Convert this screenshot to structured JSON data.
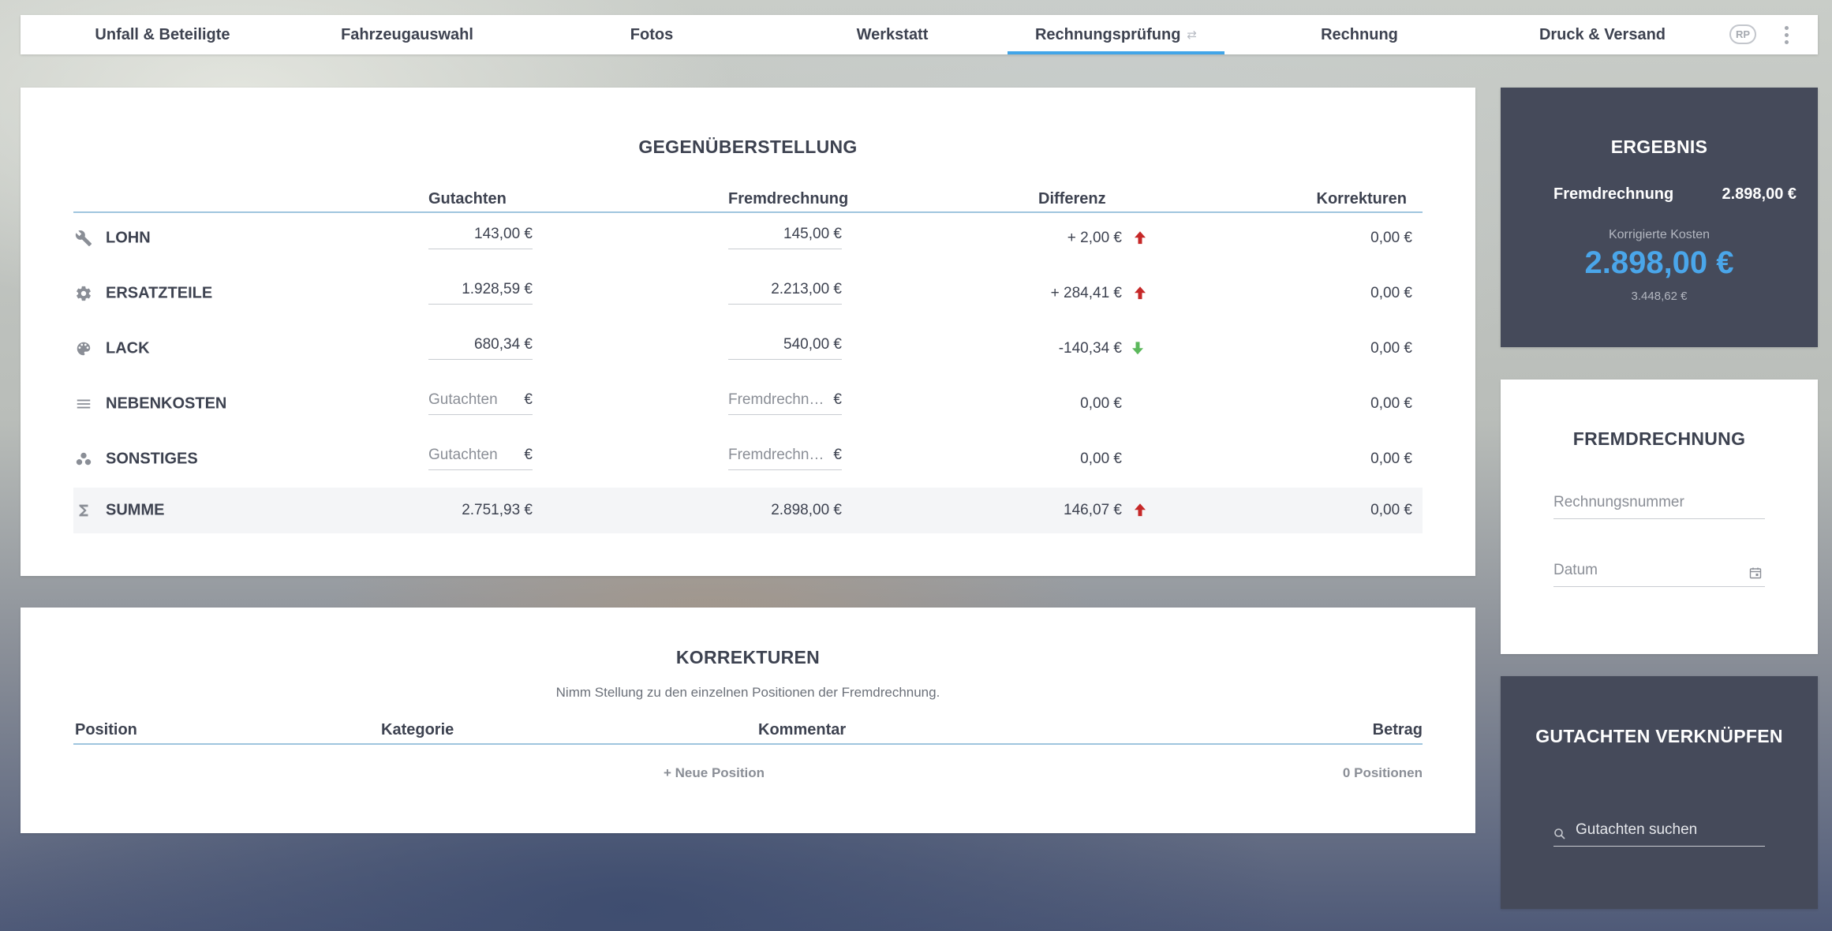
{
  "nav": {
    "tabs": [
      {
        "label": "Unfall & Beteiligte"
      },
      {
        "label": "Fahrzeugauswahl"
      },
      {
        "label": "Fotos"
      },
      {
        "label": "Werkstatt"
      },
      {
        "label": "Rechnungsprüfung",
        "active": true
      },
      {
        "label": "Rechnung"
      },
      {
        "label": "Druck & Versand"
      }
    ],
    "user_badge": "RP"
  },
  "comparison": {
    "title": "GEGENÜBERSTELLUNG",
    "columns": {
      "gutachten": "Gutachten",
      "fremdrechnung": "Fremdrechnung",
      "differenz": "Differenz",
      "korrekturen": "Korrekturen"
    },
    "rows": [
      {
        "label": "LOHN",
        "icon": "wrench-icon",
        "gutachten": "143,00 €",
        "fremdrechnung": "145,00 €",
        "differenz": "+ 2,00 €",
        "trend": "up",
        "korrekturen": "0,00 €"
      },
      {
        "label": "ERSATZTEILE",
        "icon": "gear-icon",
        "gutachten": "1.928,59 €",
        "fremdrechnung": "2.213,00 €",
        "differenz": "+ 284,41 €",
        "trend": "up",
        "korrekturen": "0,00 €"
      },
      {
        "label": "LACK",
        "icon": "palette-icon",
        "gutachten": "680,34 €",
        "fremdrechnung": "540,00 €",
        "differenz": "-140,34 €",
        "trend": "down",
        "korrekturen": "0,00 €"
      },
      {
        "label": "NEBENKOSTEN",
        "icon": "list-icon",
        "gutachten_placeholder": "Gutachten",
        "fremdrechnung_placeholder": "Fremdrechn…",
        "currency": "€",
        "differenz": "0,00 €",
        "korrekturen": "0,00 €"
      },
      {
        "label": "SONSTIGES",
        "icon": "dots-cluster-icon",
        "gutachten_placeholder": "Gutachten",
        "fremdrechnung_placeholder": "Fremdrechn…",
        "currency": "€",
        "differenz": "0,00 €",
        "korrekturen": "0,00 €"
      }
    ],
    "sum": {
      "label": "SUMME",
      "icon": "sigma-icon",
      "gutachten": "2.751,93 €",
      "fremdrechnung": "2.898,00 €",
      "differenz": "146,07 €",
      "trend": "up",
      "korrekturen": "0,00 €"
    }
  },
  "corrections": {
    "title": "KORREKTUREN",
    "subtitle": "Nimm Stellung zu den einzelnen Positionen der Fremdrechnung.",
    "columns": {
      "position": "Position",
      "kategorie": "Kategorie",
      "kommentar": "Kommentar",
      "betrag": "Betrag"
    },
    "new_position": "+ Neue Position",
    "count": "0 Positionen"
  },
  "result": {
    "title": "ERGEBNIS",
    "fremd_label": "Fremdrechnung",
    "fremd_value": "2.898,00 €",
    "corrected_label": "Korrigierte Kosten",
    "corrected_value": "2.898,00 €",
    "original_value": "3.448,62 €"
  },
  "invoice": {
    "title": "FREMDRECHNUNG",
    "number_placeholder": "Rechnungsnummer",
    "date_placeholder": "Datum"
  },
  "link": {
    "title": "GUTACHTEN VERKNÜPFEN",
    "search_placeholder": "Gutachten suchen"
  },
  "colors": {
    "accent": "#42a5e8",
    "up": "#c62828",
    "down": "#5cb85c",
    "dark_card": "#454a5a"
  }
}
